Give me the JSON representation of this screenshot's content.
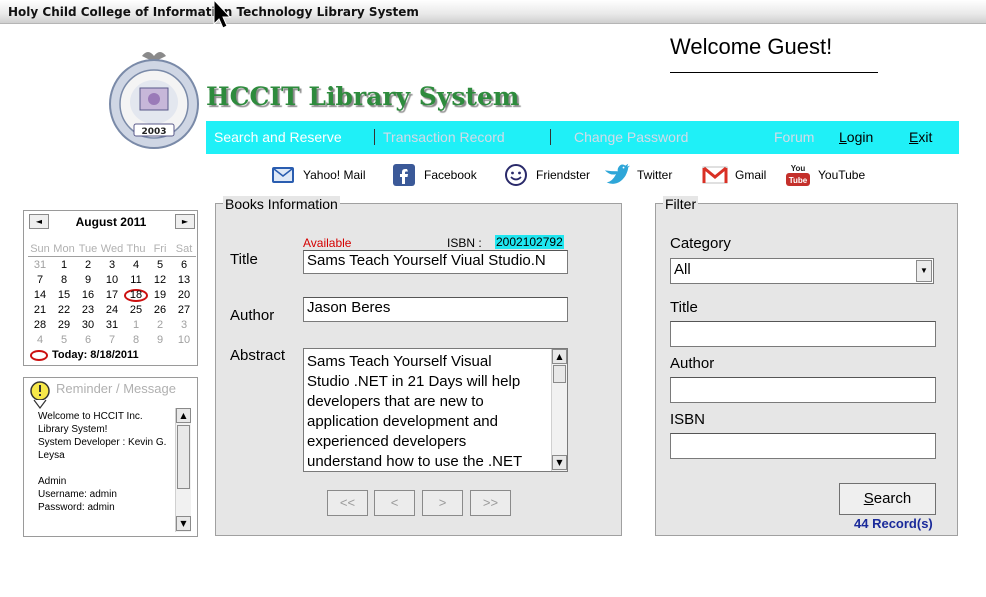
{
  "window": {
    "title": "Holy Child College of Information Technology Library System"
  },
  "header": {
    "app_name": "HCCIT Library System",
    "welcome": "Welcome Guest!",
    "logo_year": "2003"
  },
  "nav": {
    "items": [
      {
        "label": "Search and Reserve"
      },
      {
        "label": "Transaction Record"
      },
      {
        "label": "Change Password"
      },
      {
        "label": "Forum"
      },
      {
        "label_key": "L",
        "label_rest": "ogin"
      },
      {
        "label_key": "E",
        "label_rest": "xit"
      }
    ]
  },
  "social": [
    {
      "label": "Yahoo! Mail",
      "icon": "mail-icon"
    },
    {
      "label": "Facebook",
      "icon": "facebook-icon"
    },
    {
      "label": "Friendster",
      "icon": "friendster-icon"
    },
    {
      "label": "Twitter",
      "icon": "twitter-icon"
    },
    {
      "label": "Gmail",
      "icon": "gmail-icon"
    },
    {
      "label": "YouTube",
      "icon": "youtube-icon",
      "badge_top": "You",
      "badge_bottom": "Tube"
    }
  ],
  "calendar": {
    "title": "August 2011",
    "prev": "◄",
    "next": "►",
    "dows": [
      "Sun",
      "Mon",
      "Tue",
      "Wed",
      "Thu",
      "Fri",
      "Sat"
    ],
    "days": [
      "31",
      "1",
      "2",
      "3",
      "4",
      "5",
      "6",
      "7",
      "8",
      "9",
      "10",
      "11",
      "12",
      "13",
      "14",
      "15",
      "16",
      "17",
      "18",
      "19",
      "20",
      "21",
      "22",
      "23",
      "24",
      "25",
      "26",
      "27",
      "28",
      "29",
      "30",
      "31",
      "1",
      "2",
      "3",
      "4",
      "5",
      "6",
      "7",
      "8",
      "9",
      "10"
    ],
    "today_label": "Today: 8/18/2011"
  },
  "reminder": {
    "title": "Reminder / Message",
    "text": "Welcome to HCCIT Inc.\nLibrary System!\nSystem Developer : Kevin G.\nLeysa\n\nAdmin\nUsername: admin\nPassword: admin"
  },
  "books": {
    "legend": "Books Information",
    "status": "Available",
    "isbn_label": "ISBN :",
    "isbn": "2002102792",
    "title_label": "Title",
    "title_value": "Sams Teach Yourself Viual Studio.N",
    "author_label": "Author",
    "author_value": "Jason Beres",
    "abstract_label": "Abstract",
    "abstract_value": "Sams Teach Yourself Visual\nStudio .NET in 21 Days will help\ndevelopers that are new to\napplication development and\nexperienced developers\nunderstand how to use the .NET",
    "buttons": {
      "first": "<<",
      "prev": "<",
      "next": ">",
      "last": ">>"
    }
  },
  "filter": {
    "legend": "Filter",
    "category_label": "Category",
    "category_value": "All",
    "title_label": "Title",
    "author_label": "Author",
    "isbn_label": "ISBN",
    "search_key": "S",
    "search_rest": "earch",
    "records": "44 Record(s)"
  }
}
